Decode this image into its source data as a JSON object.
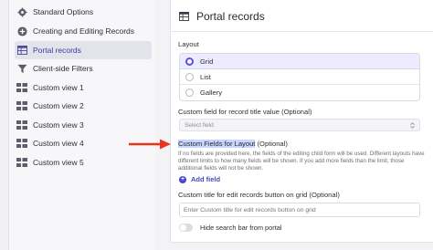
{
  "sidebar": {
    "items": [
      {
        "label": "Standard Options",
        "icon": "gear-icon"
      },
      {
        "label": "Creating and Editing Records",
        "icon": "plus-circle-icon"
      },
      {
        "label": "Portal records",
        "icon": "table-icon"
      },
      {
        "label": "Client-side Filters",
        "icon": "filter-icon"
      },
      {
        "label": "Custom view 1",
        "icon": "view-icon"
      },
      {
        "label": "Custom view 2",
        "icon": "view-icon"
      },
      {
        "label": "Custom view 3",
        "icon": "view-icon"
      },
      {
        "label": "Custom view 4",
        "icon": "view-icon"
      },
      {
        "label": "Custom view 5",
        "icon": "view-icon"
      }
    ],
    "active_index": 2
  },
  "panel": {
    "title": "Portal records",
    "layout": {
      "label": "Layout",
      "options": [
        "Grid",
        "List",
        "Gallery"
      ],
      "selected": "Grid"
    },
    "title_field": {
      "label": "Custom field for record title value (Optional)",
      "placeholder": "Select field"
    },
    "fields": {
      "label_highlight": "Custom Fields for Layout",
      "label_rest": " (Optional)",
      "help": "If no fields are provided here, the fields of the editing child form will be used. Different layouts have different limits to how many fields will be shown. If you add more fields than the limit, those additional fields will not be shown.",
      "add_label": "Add field"
    },
    "edit_button": {
      "label": "Custom title for edit records button on grid (Optional)",
      "placeholder": "Enter Custom title for edit records button on grid"
    },
    "toggle": {
      "label": "Hide search bar from portal",
      "on": false
    }
  },
  "colors": {
    "accent": "#5a50e6",
    "annotation_arrow": "#e8341c",
    "highlight": "#c7d6ff"
  }
}
